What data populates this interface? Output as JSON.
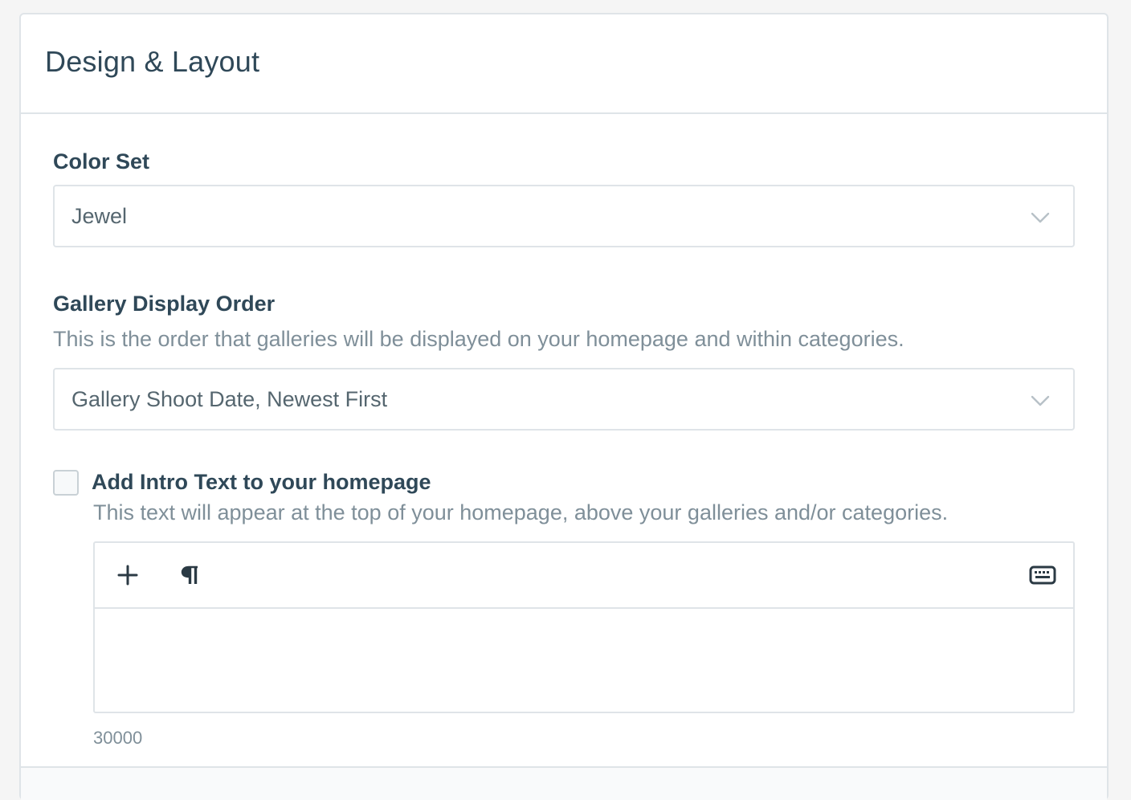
{
  "panel": {
    "title": "Design & Layout"
  },
  "color_set": {
    "label": "Color Set",
    "selected": "Jewel"
  },
  "gallery_order": {
    "label": "Gallery Display Order",
    "help": "This is the order that galleries will be displayed on your homepage and within categories.",
    "selected": "Gallery Shoot Date, Newest First"
  },
  "intro_text": {
    "checkbox_label": "Add Intro Text to your homepage",
    "checked": false,
    "help": "This text will appear at the top of your homepage, above your galleries and/or categories.",
    "toolbar": {
      "add_icon": "plus-icon",
      "paragraph_icon": "pilcrow-icon",
      "keyboard_icon": "keyboard-icon"
    },
    "char_count": "30000"
  }
}
